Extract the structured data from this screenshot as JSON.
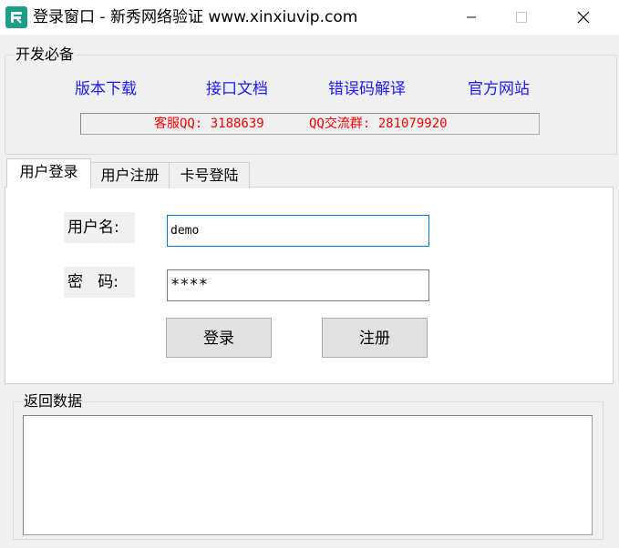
{
  "window": {
    "title": "登录窗口 - 新秀网络验证 www.xinxiuvip.com",
    "icon": "app-logo-icon"
  },
  "dev_group": {
    "title": "开发必备",
    "links": [
      "版本下载",
      "接口文档",
      "错误码解译",
      "官方网站"
    ],
    "contact": {
      "service": "客服QQ: 3188639",
      "group": "QQ交流群: 281079920"
    },
    "link_color": "#1a1aff",
    "contact_color": "#ff0000"
  },
  "tabs": [
    "用户登录",
    "用户注册",
    "卡号登陆"
  ],
  "login": {
    "username_label": "用户名:",
    "password_label": "密   码:",
    "username_value": "demo",
    "password_value": "****",
    "login_button": "登录",
    "register_button": "注册"
  },
  "output_group": {
    "title": "返回数据",
    "content": ""
  }
}
